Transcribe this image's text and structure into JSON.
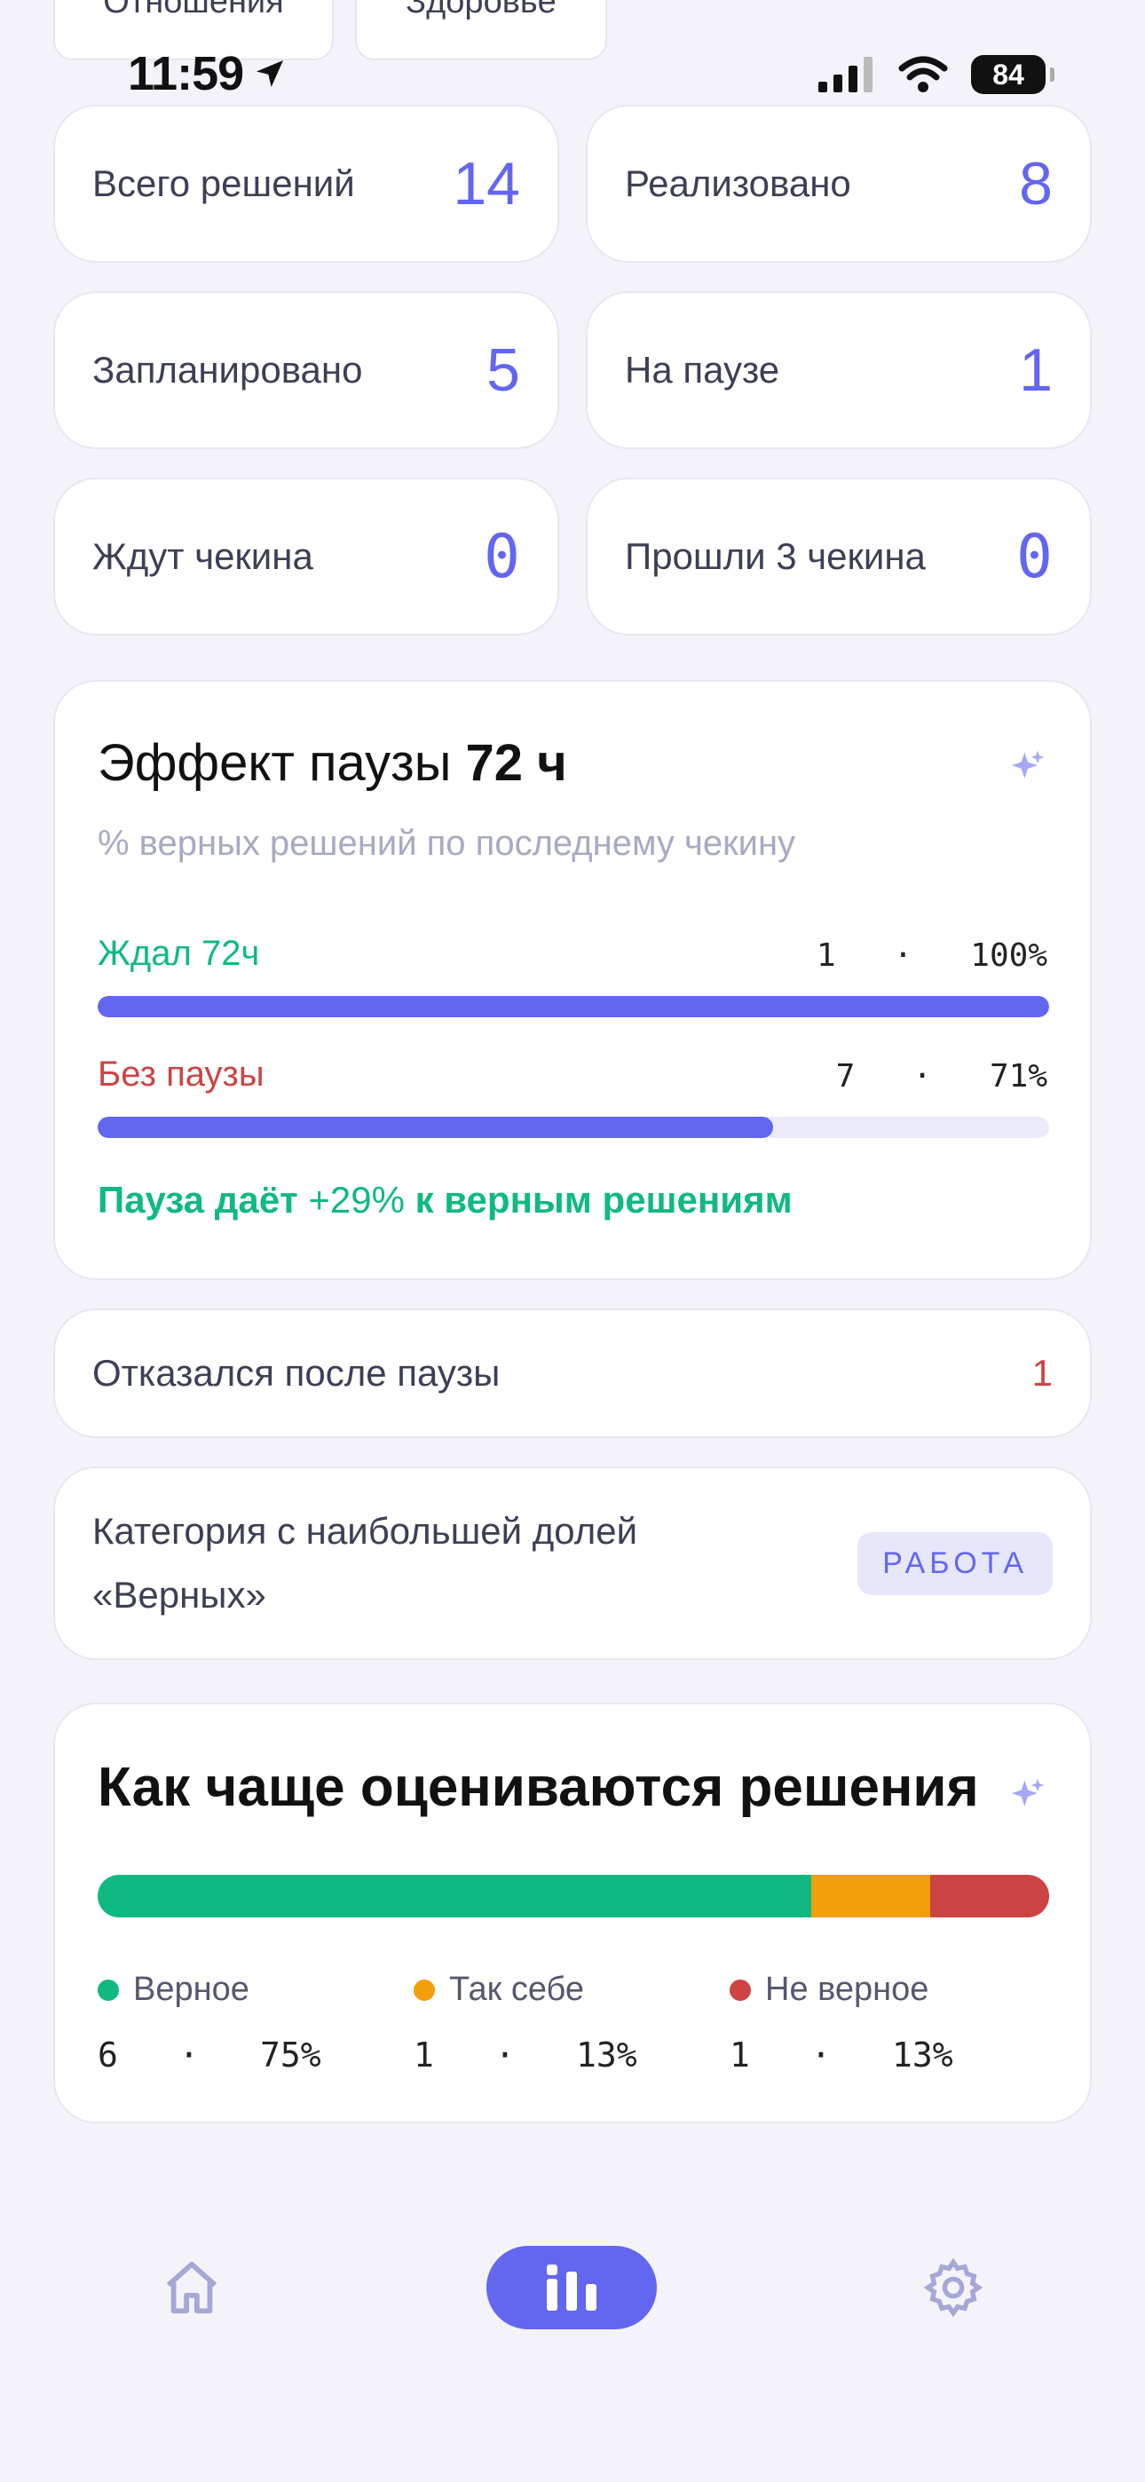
{
  "filters": [
    "Отношения",
    "Здоровье"
  ],
  "status_bar": {
    "time": "11:59",
    "battery": "84"
  },
  "stats": [
    {
      "label": "Всего решений",
      "value": "14"
    },
    {
      "label": "Реализовано",
      "value": "8"
    },
    {
      "label": "Запланировано",
      "value": "5"
    },
    {
      "label": "На паузе",
      "value": "1"
    },
    {
      "label": "Ждут чекина",
      "value": "0"
    },
    {
      "label": "Прошли 3 чекина",
      "value": "0"
    }
  ],
  "pause_effect": {
    "title_prefix": "Эффект паузы",
    "title_value": "72 ч",
    "subtitle": "% верных решений по последнему чекину",
    "rows": [
      {
        "label": "Ждал 72ч",
        "count": "1",
        "percent": "100%",
        "fraction": 1.0,
        "color": "#10b981"
      },
      {
        "label": "Без паузы",
        "count": "7",
        "percent": "71%",
        "fraction": 0.71,
        "color": "#cc4444"
      }
    ],
    "summary_pre": "Пауза даёт",
    "summary_delta": "+29%",
    "summary_post": "к верным решениям"
  },
  "refused_after_pause": {
    "label": "Отказался после паузы",
    "value": "1"
  },
  "top_category": {
    "label_line1": "Категория с наибольшей долей",
    "label_line2": "«Верных»",
    "badge": "РАБОТА"
  },
  "ratings": {
    "title": "Как чаще оцениваются решения",
    "items": [
      {
        "label": "Верное",
        "count": "6",
        "percent": "75%",
        "fraction": 0.75,
        "color": "#10b981"
      },
      {
        "label": "Так себе",
        "count": "1",
        "percent": "13%",
        "fraction": 0.125,
        "color": "#f59e0b"
      },
      {
        "label": "Не верное",
        "count": "1",
        "percent": "13%",
        "fraction": 0.125,
        "color": "#cc4444"
      }
    ]
  },
  "nav": {
    "active": "stats",
    "icons": [
      "home-icon",
      "stats-icon",
      "settings-icon"
    ]
  }
}
